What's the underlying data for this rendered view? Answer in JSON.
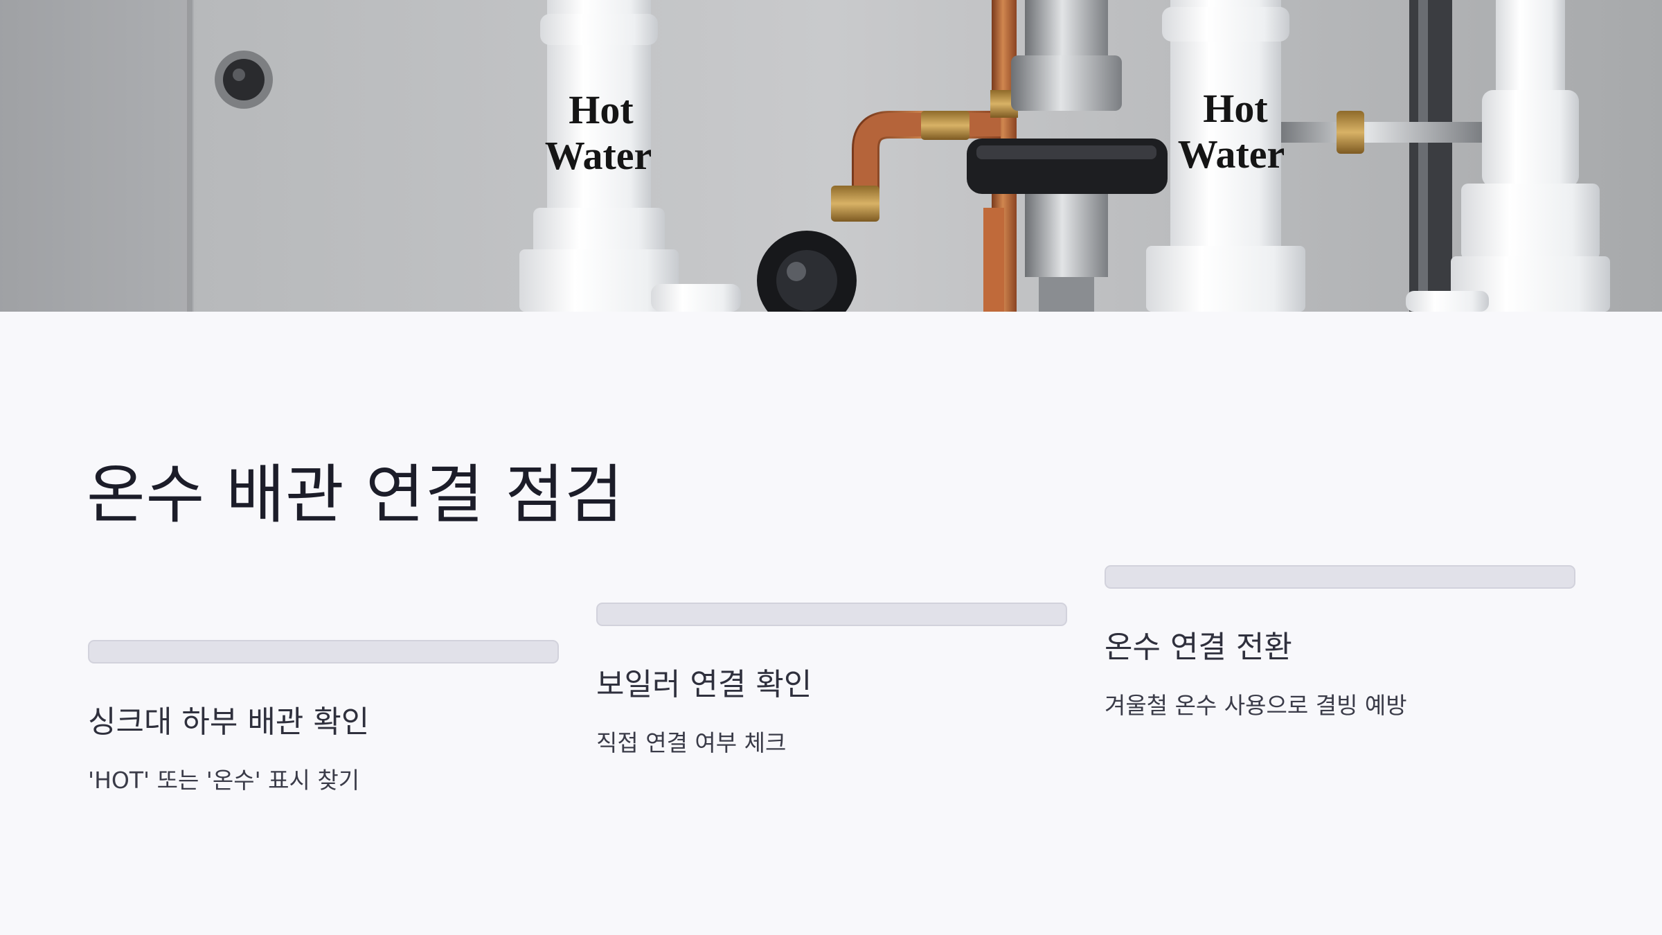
{
  "hero": {
    "left_pipe_label_line1": "Hot",
    "left_pipe_label_line2": "Water",
    "right_pipe_label_line1": "Hot",
    "right_pipe_label_line2": "Water"
  },
  "slide": {
    "title": "온수 배관 연결 점검"
  },
  "steps": [
    {
      "title": "싱크대 하부 배관 확인",
      "description": "'HOT' 또는 '온수' 표시 찾기"
    },
    {
      "title": "보일러 연결 확인",
      "description": "직접 연결 여부 체크"
    },
    {
      "title": "온수 연결 전환",
      "description": "겨울철 온수 사용으로 결빙 예방"
    }
  ],
  "colors": {
    "background": "#f8f8fb",
    "title_text": "#1c1d29",
    "step_bar": "#e1e1e9",
    "copper_pipe": "#b5643a",
    "pvc_pipe": "#f4f5f7"
  }
}
